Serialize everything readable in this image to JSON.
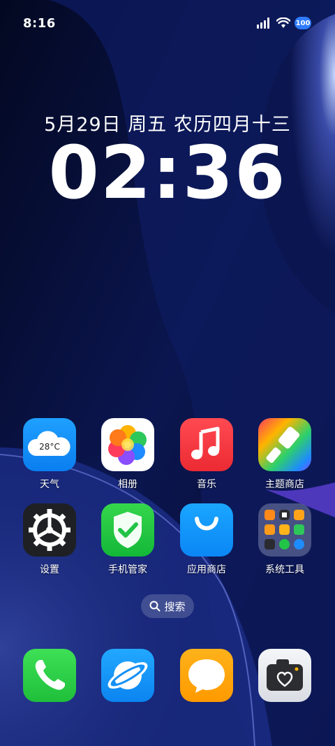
{
  "status_bar": {
    "time": "8:16",
    "battery": "100",
    "icons": [
      "signal-icon",
      "wifi-icon",
      "battery-icon"
    ]
  },
  "lockclock": {
    "date": "5月29日 周五 农历四月十三",
    "time": "02:36"
  },
  "apps": [
    {
      "label": "天气",
      "icon": "weather-icon",
      "temp": "28°C"
    },
    {
      "label": "相册",
      "icon": "gallery-icon"
    },
    {
      "label": "音乐",
      "icon": "music-icon"
    },
    {
      "label": "主题商店",
      "icon": "theme-store-icon"
    },
    {
      "label": "设置",
      "icon": "settings-icon"
    },
    {
      "label": "手机管家",
      "icon": "security-icon"
    },
    {
      "label": "应用商店",
      "icon": "app-store-icon"
    },
    {
      "label": "系统工具",
      "icon": "folder-icon"
    }
  ],
  "search": {
    "label": "搜索"
  },
  "dock": [
    {
      "icon": "phone-icon"
    },
    {
      "icon": "browser-icon"
    },
    {
      "icon": "messages-icon"
    },
    {
      "icon": "camera-icon"
    }
  ],
  "colors": {
    "background": "#050b2e",
    "accent_blue": "#0a7ef0",
    "accent_green": "#1fbf3b",
    "accent_red": "#ec2a33",
    "accent_orange": "#ff9a00"
  }
}
